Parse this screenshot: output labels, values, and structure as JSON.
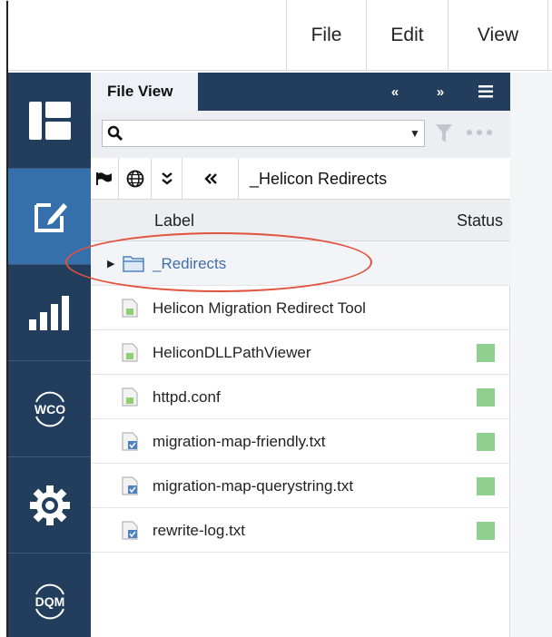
{
  "menu": {
    "file": "File",
    "edit": "Edit",
    "view": "View"
  },
  "rail": [
    {
      "icon": "dashboard-icon"
    },
    {
      "icon": "edit-icon",
      "active": true
    },
    {
      "icon": "chart-icon"
    },
    {
      "icon": "wco-icon",
      "label": "WCO"
    },
    {
      "icon": "gear-icon"
    },
    {
      "icon": "dqm-icon",
      "label": "DQM"
    }
  ],
  "panel": {
    "tab_label": "File View",
    "breadcrumb": "_Helicon Redirects",
    "columns": {
      "label": "Label",
      "status": "Status"
    }
  },
  "rows": [
    {
      "label": "_Redirects",
      "type": "folder",
      "status": null
    },
    {
      "label": "Helicon Migration Redirect Tool",
      "type": "file",
      "status": null
    },
    {
      "label": "HeliconDLLPathViewer",
      "type": "file",
      "status": "ok"
    },
    {
      "label": "httpd.conf",
      "type": "file",
      "status": "ok"
    },
    {
      "label": "migration-map-friendly.txt",
      "type": "text",
      "status": "ok"
    },
    {
      "label": "migration-map-querystring.txt",
      "type": "text",
      "status": "ok"
    },
    {
      "label": "rewrite-log.txt",
      "type": "text",
      "status": "ok"
    }
  ],
  "colors": {
    "rail": "#233e5d",
    "rail_active": "#3570ad",
    "status_ok": "#8fd08f",
    "highlight": "#e1523f"
  }
}
